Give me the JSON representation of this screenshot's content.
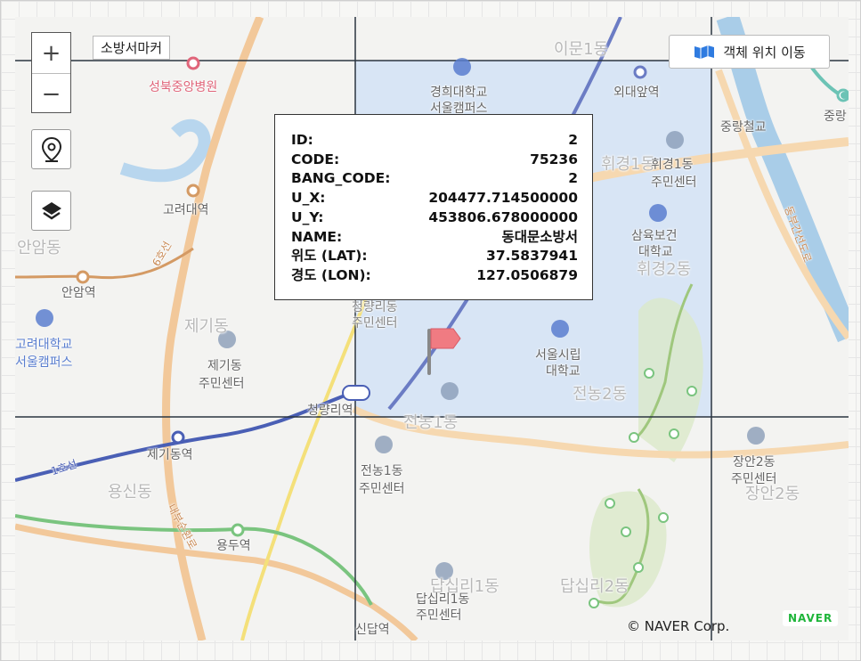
{
  "controls": {
    "zoom_in": "+",
    "zoom_out": "−",
    "marker_label": "소방서마커",
    "move_button": "객체 위치 이동"
  },
  "popup": {
    "rows": [
      {
        "key": "ID:",
        "value": "2"
      },
      {
        "key": "CODE:",
        "value": "75236"
      },
      {
        "key": "BANG_CODE:",
        "value": "2"
      },
      {
        "key": "U_X:",
        "value": "204477.714500000"
      },
      {
        "key": "U_Y:",
        "value": "453806.678000000"
      },
      {
        "key": "NAME:",
        "value": "동대문소방서"
      },
      {
        "key": "위도 (LAT):",
        "value": "37.5837941"
      },
      {
        "key": "경도 (LON):",
        "value": "127.0506879"
      }
    ]
  },
  "map_labels": {
    "seongbuk_hospital": "성북중앙병원",
    "imun1": "이문1동",
    "kyunghee": "경희대학교",
    "kyunghee_campus": "서울캠퍼스",
    "hoegi_station": "외대앞역",
    "jungnang_rail": "중랑철교",
    "jungnang_partial": "중랑",
    "korea_univ_station": "고려대역",
    "hwigyeong1": "휘경1동",
    "hwigyeong1_center_a": "휘경1동",
    "hwigyeong1_center_b": "주민센터",
    "samyuk_a": "삼육보건",
    "samyuk_b": "대학교",
    "hwigyeong2": "휘경2동",
    "anam_dong": "안암동",
    "anam_station": "안암역",
    "line6": "6호선",
    "korea_univ_a": "고려대학교",
    "korea_univ_b": "서울캠퍼스",
    "jegi_dong": "제기동",
    "jegi_center_a": "제기동",
    "jegi_center_b": "주민센터",
    "cheongnyangri_center_a": "청량리동",
    "cheongnyangri_center_b": "주민센터",
    "uos_a": "서울시립",
    "uos_b": "대학교",
    "jeonnong2": "전농2동",
    "cheongnyangni_station": "청량리역",
    "jeonnong1": "전농1동",
    "jegidong_station": "제기동역",
    "line1": "1호선",
    "jeonnong1_center_a": "전농1동",
    "jeonnong1_center_b": "주민센터",
    "jangan2_center_a": "장안2동",
    "jangan2_center_b": "주민센터",
    "jangan2": "장안2동",
    "yongsin": "용신동",
    "naebu_road": "내부순환로",
    "yongdu_station": "용두역",
    "dongbu_road": "동부간선도로",
    "dapsimni1": "답십리1동",
    "dapsimni1_center_a": "답십리1동",
    "dapsimni1_center_b": "주민센터",
    "dapsimni2": "답십리2동",
    "sindap_station": "신답역"
  },
  "attribution": {
    "copyright": "© NAVER Corp.",
    "logo": "NAVER"
  },
  "colors": {
    "highlight_cell": "#cfe0f5",
    "grid_line": "#2b3540",
    "road_orange": "#f2c89a",
    "subway_line1": "#4a5fb5",
    "subway_green": "#7ac47f",
    "stream": "#a9cde8",
    "flag": "#f07b82"
  }
}
